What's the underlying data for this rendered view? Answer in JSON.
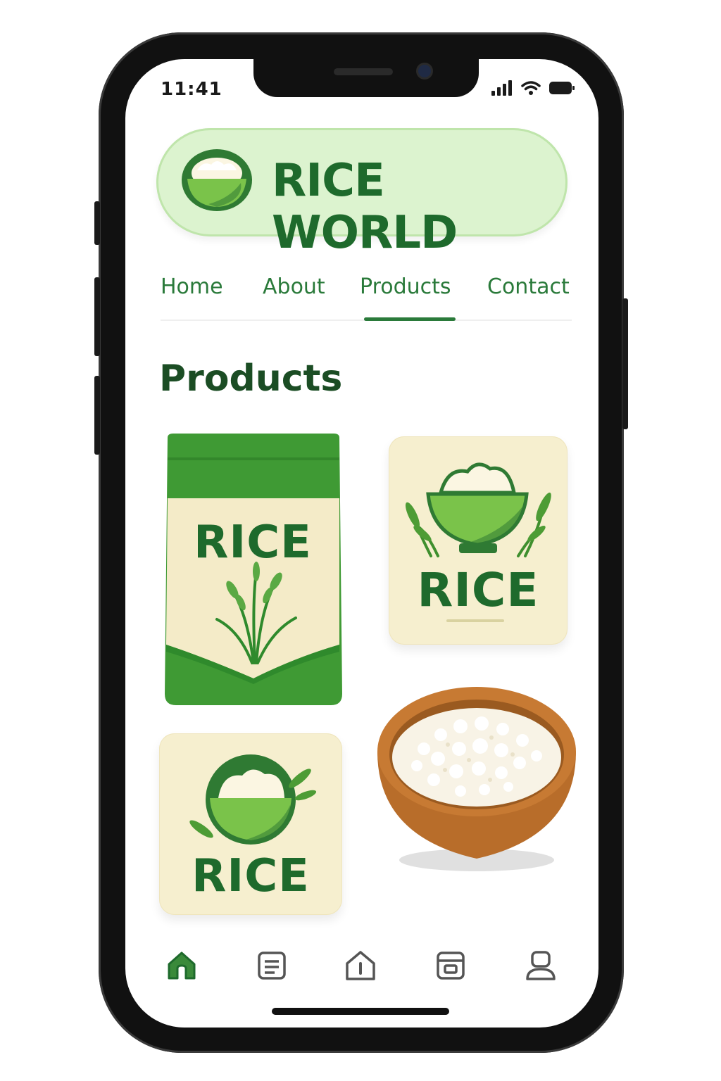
{
  "status_bar": {
    "time": "11:41",
    "icons": [
      "signal-icon",
      "wifi-icon",
      "battery-icon"
    ]
  },
  "header": {
    "brand": "RICE WORLD",
    "logo_icon": "rice-bowl-icon"
  },
  "nav": {
    "items": [
      {
        "label": "Home"
      },
      {
        "label": "About"
      },
      {
        "label": "Products"
      },
      {
        "label": "Contact"
      }
    ],
    "active": "Products"
  },
  "main": {
    "title": "Products",
    "products": [
      {
        "label": "RICE",
        "icon": "rice-bag-image"
      },
      {
        "label": "RICE",
        "icon": "rice-bowl-logo-image"
      },
      {
        "label": "RICE",
        "icon": "rice-bowl-badge-image"
      },
      {
        "label": "",
        "icon": "wooden-rice-bowl-image"
      }
    ]
  },
  "bottom_nav": {
    "tabs": [
      "home-icon",
      "list-icon",
      "info-icon",
      "archive-icon",
      "profile-icon"
    ],
    "active": "home-icon"
  },
  "colors": {
    "brand_green": "#1e6a2c",
    "nav_green": "#2a7a3a",
    "pill_bg": "#dcf3cf",
    "card_bg": "#f6efcf"
  }
}
